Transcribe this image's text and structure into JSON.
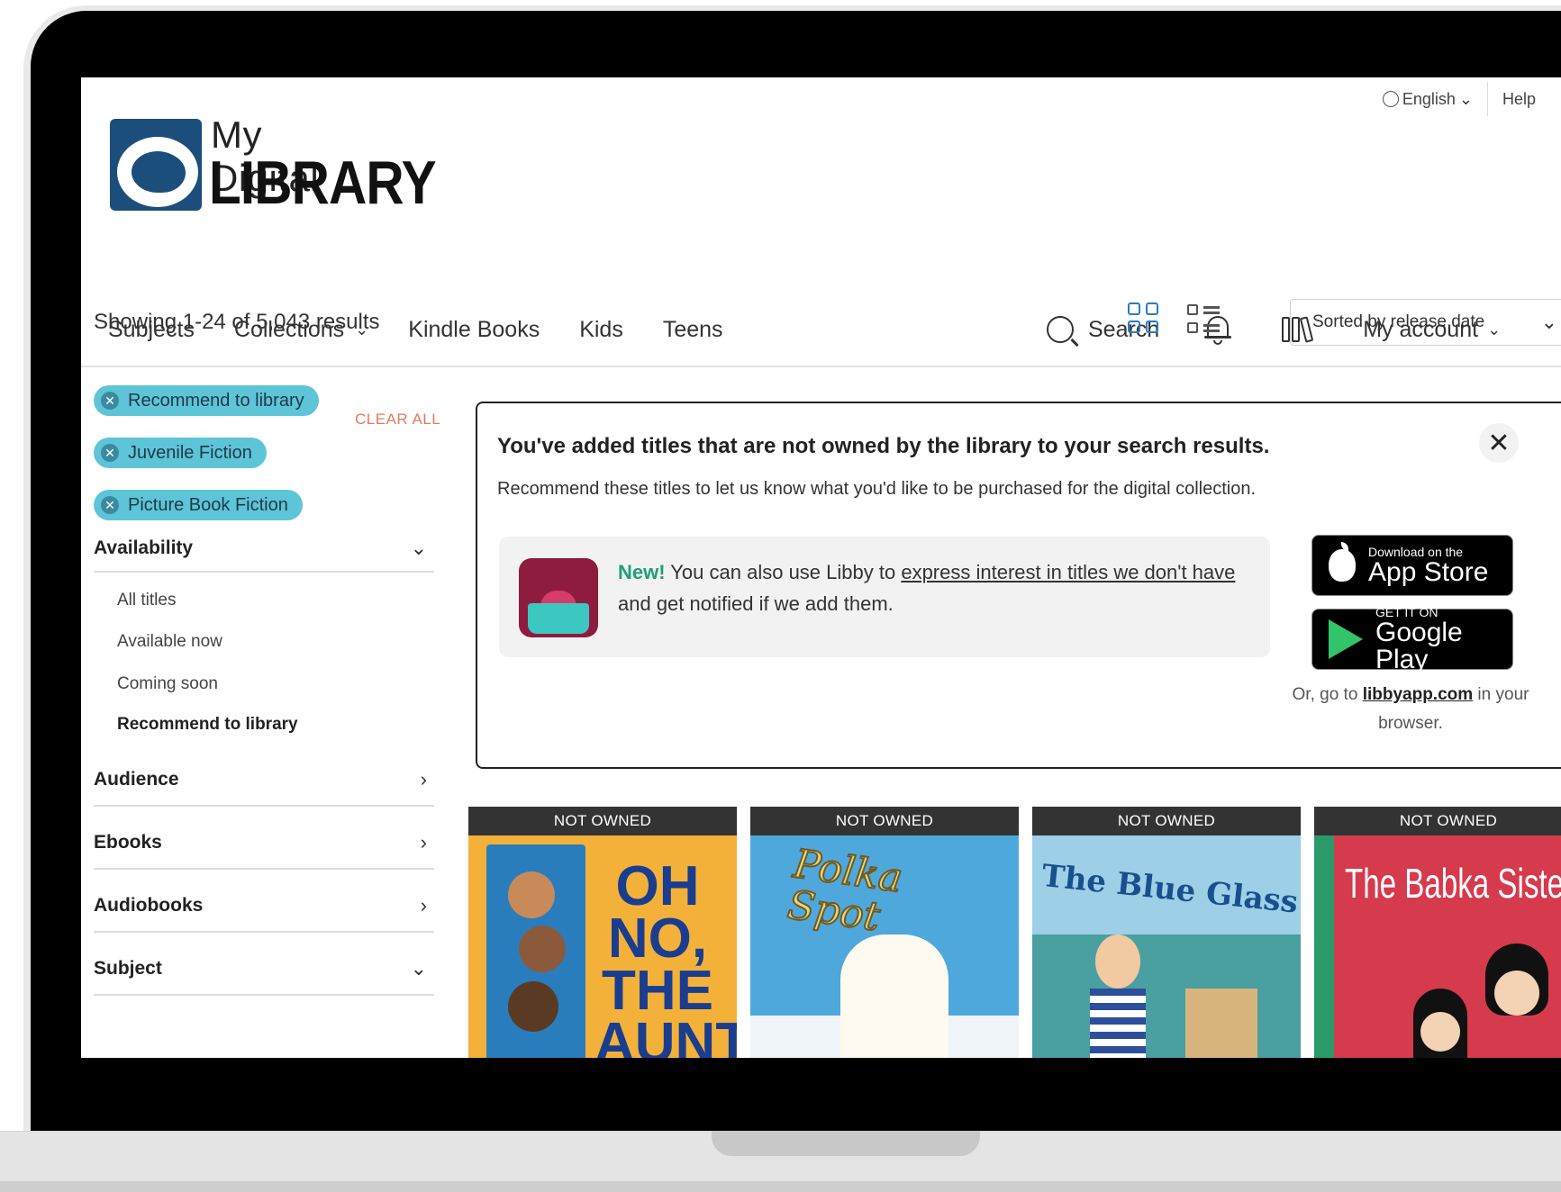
{
  "header": {
    "language": "English",
    "help": "Help",
    "logo_line1": "My Digital",
    "logo_line2": "LIBRARY"
  },
  "nav": {
    "items": [
      "Subjects",
      "Collections",
      "Kindle Books",
      "Kids",
      "Teens"
    ],
    "search": "Search",
    "account": "My account"
  },
  "results": {
    "summary": "Showing 1-24 of 5,043 results",
    "sort": "Sorted by release date"
  },
  "sidebar": {
    "clear_all": "CLEAR ALL",
    "chips": [
      "Recommend to library",
      "Juvenile Fiction",
      "Picture Book Fiction"
    ],
    "facets": {
      "availability": "Availability",
      "audience": "Audience",
      "ebooks": "Ebooks",
      "audiobooks": "Audiobooks",
      "subject": "Subject"
    },
    "availability_options": [
      "All titles",
      "Available now",
      "Coming soon",
      "Recommend to library"
    ]
  },
  "notice": {
    "title": "You've added titles that are not owned by the library to your search results.",
    "subtitle": "Recommend these titles to let us know what you'd like to be purchased for the digital collection.",
    "new_label": "New!",
    "libby_text1": " You can also use Libby to ",
    "libby_link": "express interest in titles we don't have",
    "libby_text2": " and get notified if we add them.",
    "appstore_small": "Download on the",
    "appstore_big": "App Store",
    "play_small": "GET IT ON",
    "play_big": "Google Play",
    "alt_pre": "Or, go to ",
    "alt_link": "libbyapp.com",
    "alt_post": " in your browser."
  },
  "books": [
    {
      "label": "NOT OWNED",
      "title": "OH NO, THE AUNTS"
    },
    {
      "label": "NOT OWNED",
      "title": "Polka Spot"
    },
    {
      "label": "NOT OWNED",
      "title": "The Blue Glass Heart"
    },
    {
      "label": "NOT OWNED",
      "title": "The Babka Sisters"
    }
  ],
  "colors": {
    "chip": "#5ec4d8",
    "clear_all": "#e07a5f",
    "accent_blue": "#2a7dbd",
    "libby_new": "#1f9f78"
  }
}
